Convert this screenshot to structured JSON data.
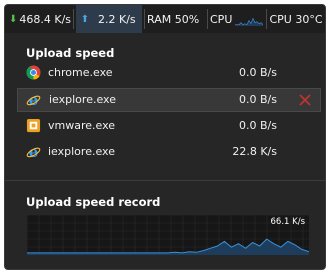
{
  "topbar": {
    "download": "468.4 K/s",
    "upload": "2.2 K/s",
    "ram": "RAM 50%",
    "cpu_label": "CPU",
    "cpu_temp": "CPU 30°C"
  },
  "upload_section": {
    "title": "Upload speed",
    "processes": [
      {
        "name": "chrome.exe",
        "speed": "0.0 B/s",
        "icon": "chrome-icon"
      },
      {
        "name": "iexplore.exe",
        "speed": "0.0 B/s",
        "icon": "internet-explorer-icon",
        "selected": true
      },
      {
        "name": "vmware.exe",
        "speed": "0.0 B/s",
        "icon": "vmware-icon"
      },
      {
        "name": "iexplore.exe",
        "speed": "22.8 K/s",
        "icon": "internet-explorer-icon"
      }
    ]
  },
  "record_section": {
    "title": "Upload speed record",
    "peak_label": "66.1 K/s"
  },
  "chart_data": {
    "type": "area",
    "title": "",
    "xlabel": "",
    "ylabel": "",
    "ylim": [
      0,
      66.1
    ],
    "grid": true,
    "series": [
      {
        "values": [
          2,
          2,
          2,
          2,
          2,
          2,
          2,
          2,
          2,
          2,
          2,
          2,
          2,
          2,
          2,
          2,
          2,
          2,
          2,
          2,
          2,
          3,
          2,
          4,
          3,
          6,
          10,
          14,
          22,
          12,
          18,
          10,
          20,
          14,
          26,
          18,
          12,
          22,
          16,
          8,
          4
        ]
      }
    ]
  },
  "colors": {
    "background": "#262626",
    "chart_line": "#3a8fd8",
    "chart_fill": "#1e3d5c",
    "close": "#c8322d"
  }
}
